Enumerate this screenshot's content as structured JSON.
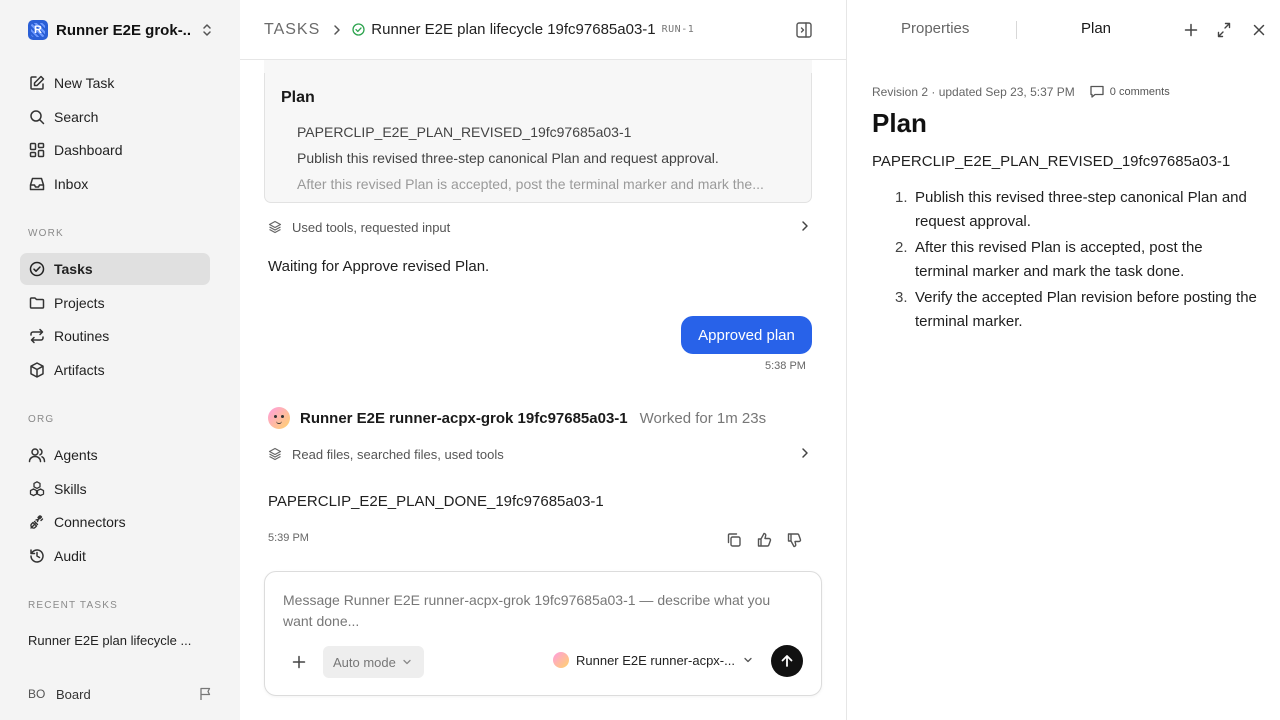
{
  "workspace": {
    "name": "Runner E2E grok-...",
    "logo_letter": "R"
  },
  "nav": {
    "new_task": "New Task",
    "search": "Search",
    "dashboard": "Dashboard",
    "inbox": "Inbox"
  },
  "sections": {
    "work": "WORK",
    "org": "ORG",
    "recent": "RECENT TASKS"
  },
  "work_items": {
    "tasks": "Tasks",
    "projects": "Projects",
    "routines": "Routines",
    "artifacts": "Artifacts"
  },
  "org_items": {
    "agents": "Agents",
    "skills": "Skills",
    "connectors": "Connectors",
    "audit": "Audit"
  },
  "recent_task": "Runner E2E plan lifecycle ...",
  "board": {
    "initials": "BO",
    "label": "Board"
  },
  "header": {
    "root": "TASKS",
    "title": "Runner E2E plan lifecycle 19fc97685a03-1",
    "run_id": "RUN-1"
  },
  "plan_card": {
    "title": "Plan",
    "items": [
      "PAPERCLIP_E2E_PLAN_REVISED_19fc97685a03-1",
      "Publish this revised three-step canonical Plan and request approval.",
      "After this revised Plan is accepted, post the terminal marker and mark the..."
    ]
  },
  "thread": {
    "tools_1": "Used tools, requested input",
    "waiting": "Waiting for Approve revised Plan.",
    "user_bubble": "Approved plan",
    "user_time": "5:38 PM",
    "agent_name": "Runner E2E runner-acpx-grok 19fc97685a03-1",
    "worked": "Worked for 1m 23s",
    "tools_2": "Read files, searched files, used tools",
    "done_msg": "PAPERCLIP_E2E_PLAN_DONE_19fc97685a03-1",
    "agent_time": "5:39 PM"
  },
  "composer": {
    "placeholder": "Message Runner E2E runner-acpx-grok 19fc97685a03-1 — describe what you want done...",
    "mode": "Auto mode",
    "agent": "Runner E2E runner-acpx-..."
  },
  "right_panel": {
    "tabs": [
      "Properties",
      "Plan"
    ],
    "active_tab": "Plan",
    "revision": "Revision 2 · updated Sep 23, 5:37 PM",
    "comments": "0 comments",
    "title": "Plan",
    "code": "PAPERCLIP_E2E_PLAN_REVISED_19fc97685a03-1",
    "steps": [
      {
        "num": "1.",
        "text": "Publish this revised three-step canonical Plan and request approval."
      },
      {
        "num": "2.",
        "text": "After this revised Plan is accepted, post the terminal marker and mark the task done."
      },
      {
        "num": "3.",
        "text": "Verify the accepted Plan revision before posting the terminal marker."
      }
    ]
  },
  "colors": {
    "accent": "#2862e9",
    "sidebar_bg": "#f4f4f4",
    "active_nav": "#e0e0e0",
    "success": "#2ea44f"
  }
}
